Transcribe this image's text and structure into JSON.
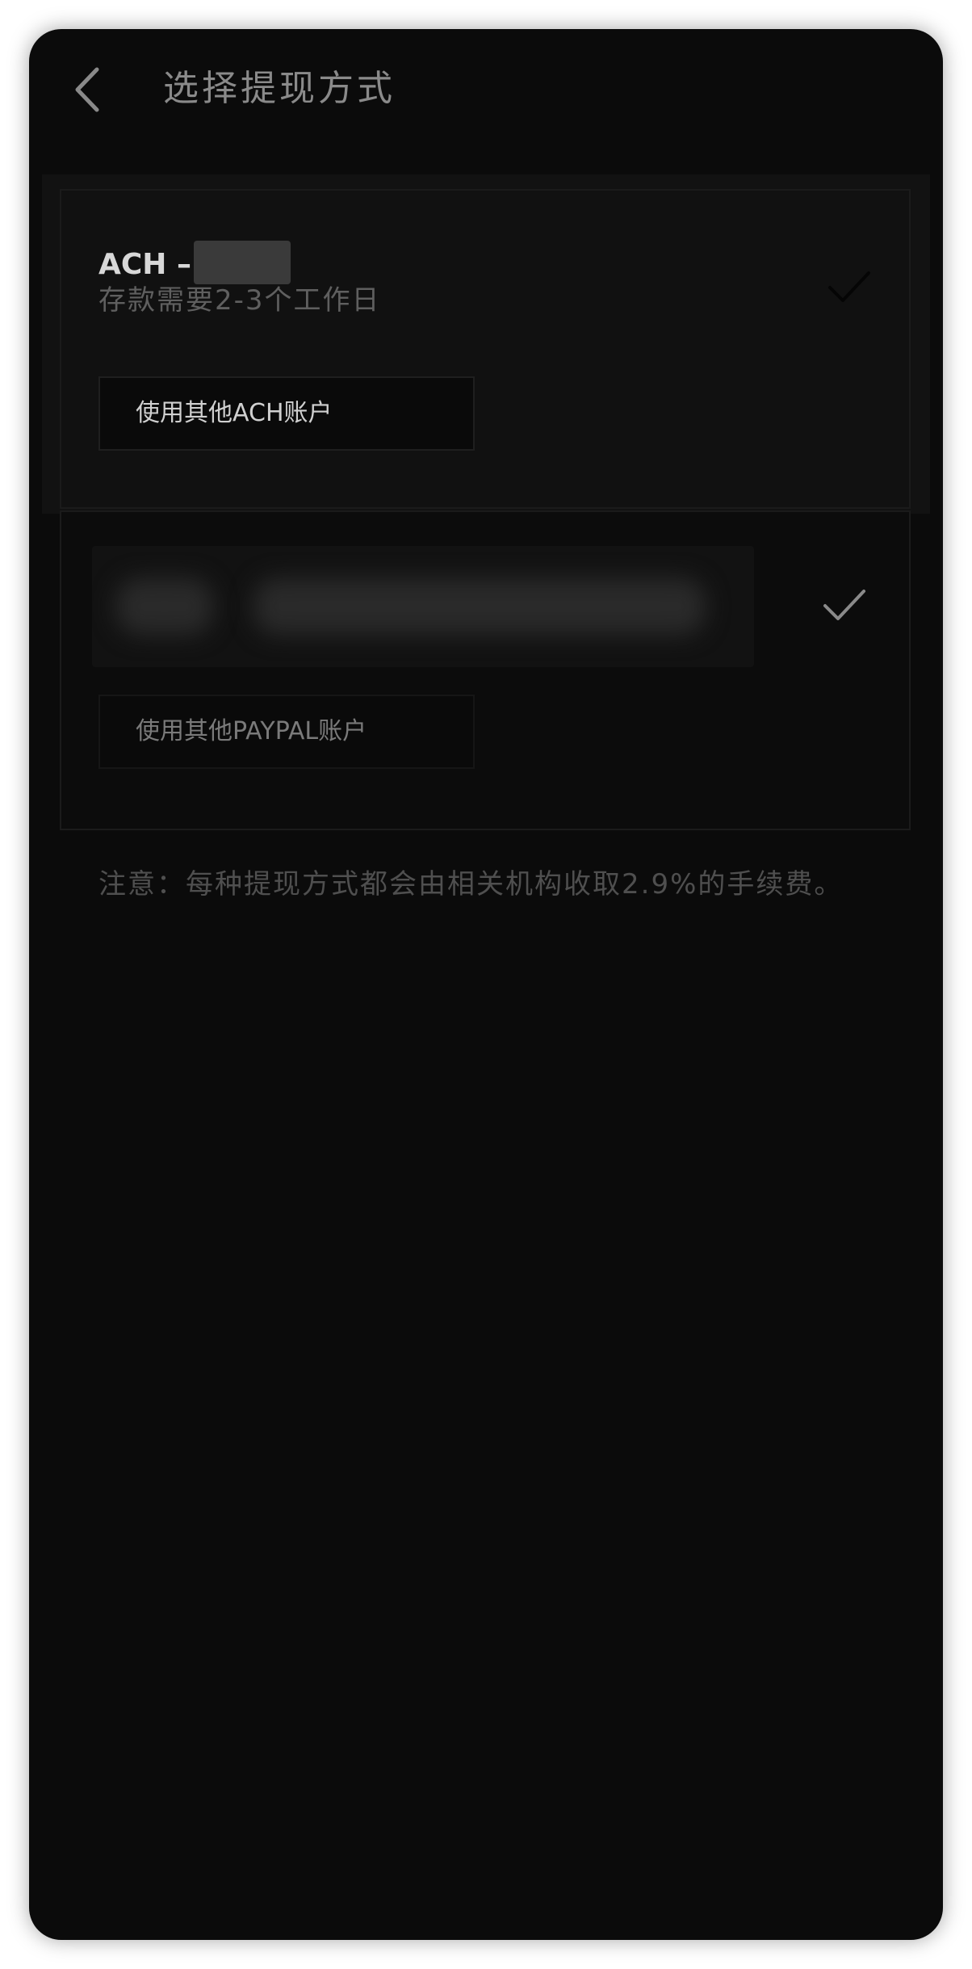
{
  "header": {
    "title": "选择提现方式",
    "back_icon": "chevron-left-icon"
  },
  "methods": [
    {
      "name": "ACH –",
      "description": "存款需要2-3个工作日",
      "alt_button_label": "使用其他ACH账户",
      "selected_icon": "checkmark-icon"
    },
    {
      "name": "",
      "description": "",
      "alt_button_label": "使用其他PAYPAL账户",
      "selected_icon": "checkmark-icon"
    }
  ],
  "notice": "注意：每种提现方式都会由相关机构收取2.9%的手续费。",
  "colors": {
    "background": "#0b0b0b",
    "frame": "#ffffff"
  }
}
